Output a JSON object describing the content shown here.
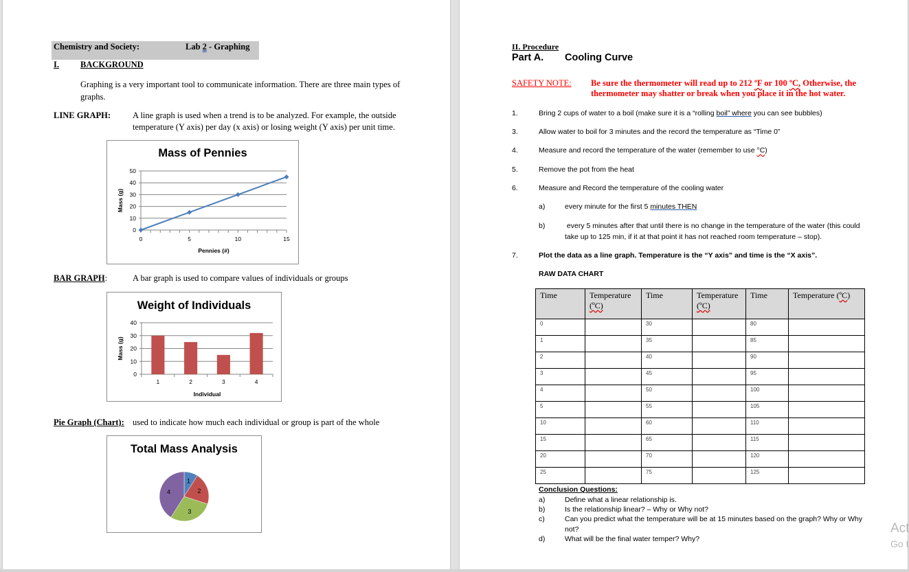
{
  "left_page": {
    "header": {
      "course": "Chemistry and Society:",
      "lab": "Lab ",
      "lab_number": "2",
      "lab_sep": " - ",
      "lab_title": "Graphing"
    },
    "section_num": "I.",
    "section_title": "BACKGROUND",
    "intro": [
      "Graphing is a very important tool to communicate information.  There are three main types of",
      "graphs."
    ],
    "line_graph": {
      "label": "LINE GRAPH:",
      "desc": [
        "A line graph is used when a trend is to be analyzed.  For example, the outside",
        "temperature (Y axis) per day (x axis) or losing weight (Y axis) per unit time."
      ]
    },
    "bar_graph": {
      "label": "BAR GRAPH",
      "colon": ":",
      "desc": "A bar graph is used to compare values of individuals or groups"
    },
    "pie_graph": {
      "label": "Pie Graph (Chart):",
      "desc": "used to indicate how much each individual or group is part of the whole"
    }
  },
  "chart_data": [
    {
      "type": "line",
      "title": "Mass of Pennies",
      "xlabel": "Pennies (#)",
      "ylabel": "Mass (g)",
      "x": [
        0,
        5,
        10,
        15
      ],
      "series": [
        {
          "name": "Mass",
          "values": [
            0,
            15,
            30,
            45
          ],
          "color": "#4a7ebb"
        }
      ],
      "xticks": [
        "0",
        "5",
        "10",
        "15"
      ],
      "yticks": [
        "0",
        "10",
        "20",
        "30",
        "40",
        "50"
      ],
      "xlim": [
        0,
        15
      ],
      "ylim": [
        0,
        50
      ],
      "grid": true
    },
    {
      "type": "bar",
      "title": "Weight of Individuals",
      "xlabel": "Individual",
      "ylabel": "Mass (g)",
      "categories": [
        "1",
        "2",
        "3",
        "4"
      ],
      "values": [
        30,
        25,
        15,
        32
      ],
      "color": "#c0504d",
      "yticks": [
        "0",
        "10",
        "20",
        "30",
        "40"
      ],
      "ylim": [
        0,
        40
      ],
      "grid": true
    },
    {
      "type": "pie",
      "title": "Total Mass Analysis",
      "labels": [
        "1",
        "2",
        "3",
        "4"
      ],
      "values": [
        9,
        21,
        29,
        41
      ],
      "colors": [
        "#4f81bd",
        "#c0504d",
        "#9bbb59",
        "#8064a2"
      ]
    }
  ],
  "right_page": {
    "section": "II.  Procedure",
    "part": "Part A.",
    "part_title": "Cooling Curve",
    "safety": {
      "label": "SAFETY NOTE:",
      "line1_a": "Be sure the thermometer will read up to 212 ",
      "deg_f": "ºF",
      "line1_b": " or 100 ",
      "deg_c": "ºC,",
      "line1_c": " Otherwise, the",
      "line2": "thermometer may shatter or break when you place it in the hot water."
    },
    "steps": [
      {
        "num": "1.",
        "pre": "Bring 2 cups of water to a boil (make sure it is a “rolling ",
        "link": "boil”  where",
        "post": " you can see bubbles)"
      },
      {
        "num": "3.",
        "text": "Allow water to boil for 3 minutes and the record the temperature as “Time 0”"
      },
      {
        "num": "4.",
        "pre": "Measure and record the temperature of the water (remember to use ",
        "wavy": "°C",
        "post": ")"
      },
      {
        "num": "5.",
        "text": "Remove the pot from the heat"
      },
      {
        "num": "6.",
        "text": "Measure and Record the temperature of the cooling water"
      },
      {
        "num": "7.",
        "text": "Plot the data as a line graph.  Temperature is the “Y axis” and time is the “X axis”."
      }
    ],
    "substeps": [
      {
        "num": "a)",
        "pre": "every minute for the first 5 ",
        "link": "minutes  THEN"
      },
      {
        "num": "b)",
        "line1": " every 5 minutes after that until there is no change in the temperature of the water (this could",
        "line2": "take up to 125 min, if it at that point it has not reached room temperature – stop)."
      }
    ],
    "raw_title": "RAW DATA CHART",
    "table": {
      "headers": [
        "Time",
        "Temperature",
        "Time",
        "Temperature",
        "Time",
        "Temperature ("
      ],
      "unit": "(ºC)",
      "unit_last": "ºC",
      "rows": [
        [
          "0",
          "",
          "30",
          "",
          "80",
          ""
        ],
        [
          "1",
          "",
          "35",
          "",
          "85",
          ""
        ],
        [
          "2",
          "",
          "40",
          "",
          "90",
          ""
        ],
        [
          "3",
          "",
          "45",
          "",
          "95",
          ""
        ],
        [
          "4",
          "",
          "50",
          "",
          "100",
          ""
        ],
        [
          "5",
          "",
          "55",
          "",
          "105",
          ""
        ],
        [
          "10",
          "",
          "60",
          "",
          "110",
          ""
        ],
        [
          "15",
          "",
          "65",
          "",
          "115",
          ""
        ],
        [
          "20",
          "",
          "70",
          "",
          "120",
          ""
        ],
        [
          "25",
          "",
          "75",
          "",
          "125",
          ""
        ]
      ]
    },
    "conclusion": {
      "title": "Conclusion Questions:",
      "items": [
        {
          "num": "a)",
          "text": "Define what a linear relationship is."
        },
        {
          "num": "b)",
          "text": "Is the relationship linear? – Why or Why not?"
        },
        {
          "num": "c)",
          "text": "Can you predict what the temperature will be at 15 minutes based on the graph?  Why or Why",
          "text2": "not?"
        },
        {
          "num": "d)",
          "text": "What will be the final water temper?  Why?"
        }
      ]
    }
  },
  "watermark": {
    "line1": "Act",
    "line2": "Go t"
  }
}
